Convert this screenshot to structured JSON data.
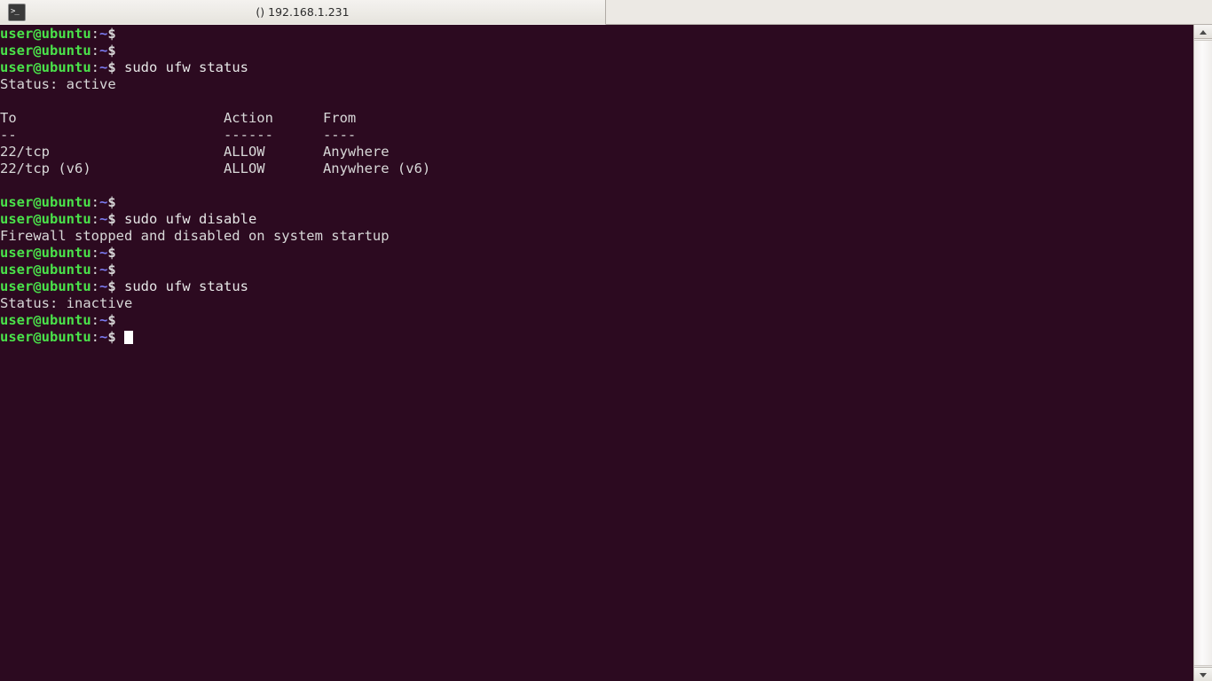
{
  "window": {
    "title": "() 192.168.1.231",
    "tab_icon": "terminal-icon"
  },
  "prompt": {
    "userhost": "user@ubuntu",
    "colon": ":",
    "path": "~",
    "dollar": "$"
  },
  "terminal": {
    "colors": {
      "background": "#2c0a20",
      "foreground": "#d8d8d8",
      "prompt_user": "#4ae24a",
      "prompt_path": "#7b7bf0",
      "cursor": "#ffffff"
    },
    "lines": [
      {
        "type": "prompt",
        "command": ""
      },
      {
        "type": "prompt",
        "command": ""
      },
      {
        "type": "prompt",
        "command": " sudo ufw status"
      },
      {
        "type": "output",
        "text": "Status: active"
      },
      {
        "type": "output",
        "text": ""
      },
      {
        "type": "output",
        "text": "To                         Action      From"
      },
      {
        "type": "output",
        "text": "--                         ------      ----"
      },
      {
        "type": "output",
        "text": "22/tcp                     ALLOW       Anywhere"
      },
      {
        "type": "output",
        "text": "22/tcp (v6)                ALLOW       Anywhere (v6)"
      },
      {
        "type": "output",
        "text": ""
      },
      {
        "type": "prompt",
        "command": ""
      },
      {
        "type": "prompt",
        "command": " sudo ufw disable"
      },
      {
        "type": "output",
        "text": "Firewall stopped and disabled on system startup"
      },
      {
        "type": "prompt",
        "command": ""
      },
      {
        "type": "prompt",
        "command": ""
      },
      {
        "type": "prompt",
        "command": " sudo ufw status"
      },
      {
        "type": "output",
        "text": "Status: inactive"
      },
      {
        "type": "prompt",
        "command": ""
      },
      {
        "type": "prompt",
        "command": "",
        "cursor": true
      }
    ],
    "ufw_table": {
      "headers": [
        "To",
        "Action",
        "From"
      ],
      "rules": [
        {
          "to": "22/tcp",
          "action": "ALLOW",
          "from": "Anywhere"
        },
        {
          "to": "22/tcp (v6)",
          "action": "ALLOW",
          "from": "Anywhere (v6)"
        }
      ],
      "status_before": "active",
      "status_after": "inactive"
    },
    "commands_run": [
      "sudo ufw status",
      "sudo ufw disable",
      "sudo ufw status"
    ]
  },
  "scrollbar": {
    "up_arrow": "chevron-up-icon",
    "down_arrow": "chevron-down-icon",
    "thumb_top_pct": 0,
    "thumb_height_pct": 100
  }
}
